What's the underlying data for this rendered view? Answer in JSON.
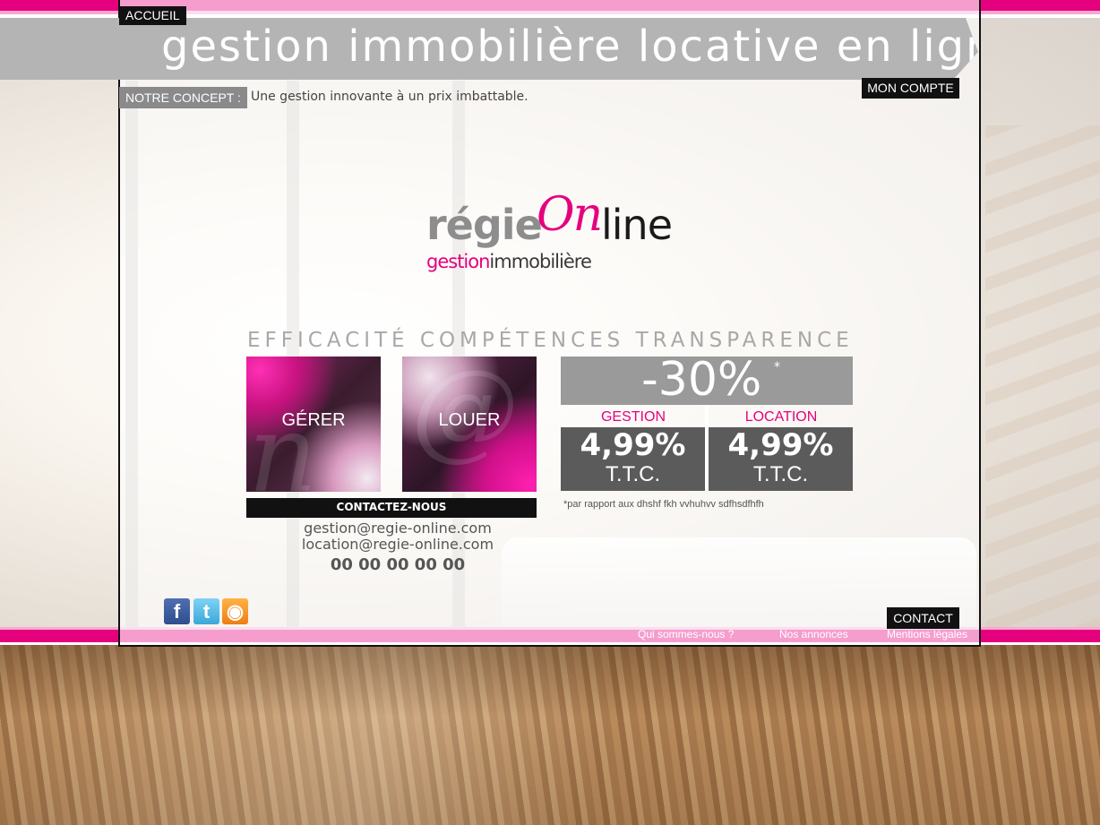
{
  "nav": {
    "home": "ACCUEIL",
    "account": "MON COMPTE",
    "contact": "CONTACT"
  },
  "header": {
    "title": "gestion immobilière locative en ligne",
    "concept_label": "NOTRE CONCEPT :",
    "concept_text": "Une gestion innovante à un prix imbattable."
  },
  "logo": {
    "part1": "régie",
    "part2": "On",
    "part3": "line",
    "tagline_a": "gestion",
    "tagline_b": "immobilière"
  },
  "values": "EFFICACITÉ COMPÉTENCES TRANSPARENCE",
  "tiles": {
    "manage": "GÉRER",
    "rent": "LOUER"
  },
  "contact": {
    "bar_label": "CONTACTEZ-NOUS",
    "email_management": "gestion@regie-online.com",
    "email_rental": "location@regie-online.com",
    "phone": "00 00 00 00 00"
  },
  "promo": {
    "discount": "-30%",
    "star": "*",
    "offers": [
      {
        "label": "GESTION",
        "rate": "4,99%",
        "suffix": "T.T.C."
      },
      {
        "label": "LOCATION",
        "rate": "4,99%",
        "suffix": "T.T.C."
      }
    ],
    "footnote": "*par rapport aux dhshf fkh vvhuhvv sdfhsdfhfh"
  },
  "social": {
    "facebook_glyph": "f",
    "twitter_glyph": "t",
    "rss_glyph": "◉"
  },
  "footer": {
    "links": [
      "Qui sommes-nous ?",
      "Nos annonces",
      "Mentions légales"
    ]
  },
  "colors": {
    "brand_pink": "#e5007e",
    "banner_grey": "#b4b4b4",
    "dark": "#111111"
  }
}
